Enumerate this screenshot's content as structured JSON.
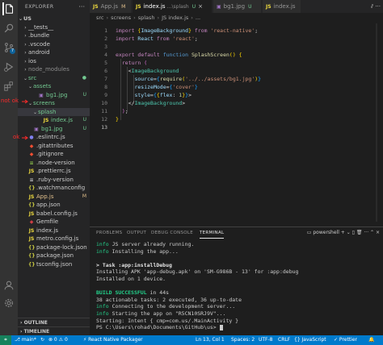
{
  "explorer": {
    "title": "EXPLORER",
    "more": "···",
    "root": "US",
    "items": [
      {
        "label": "__tests__",
        "chev": "›",
        "icon": "",
        "indent": 1,
        "status": ""
      },
      {
        "label": ".bundle",
        "chev": "›",
        "icon": "",
        "indent": 1,
        "status": ""
      },
      {
        "label": ".vscode",
        "chev": "›",
        "icon": "",
        "indent": 1,
        "status": ""
      },
      {
        "label": "android",
        "chev": "›",
        "icon": "",
        "indent": 1,
        "status": ""
      },
      {
        "label": "ios",
        "chev": "›",
        "icon": "",
        "indent": 1,
        "status": ""
      },
      {
        "label": "node_modules",
        "chev": "›",
        "icon": "",
        "indent": 1,
        "status": "",
        "cls": "ign"
      },
      {
        "label": "src",
        "chev": "⌄",
        "icon": "",
        "indent": 1,
        "status": "●",
        "cls": "untr"
      },
      {
        "label": "assets",
        "chev": "⌄",
        "icon": "",
        "indent": 2,
        "status": "",
        "cls": "untr"
      },
      {
        "label": "bg1.jpg",
        "chev": "",
        "icon": "▣",
        "iconColor": "#a074c4",
        "indent": 3,
        "status": "U",
        "cls": "untr"
      },
      {
        "label": "screens",
        "chev": "⌄",
        "icon": "",
        "indent": 2,
        "status": "",
        "cls": "untr"
      },
      {
        "label": "splash",
        "chev": "⌄",
        "icon": "",
        "indent": 3,
        "status": "",
        "cls": "untr",
        "sel": true
      },
      {
        "label": "index.js",
        "chev": "",
        "icon": "JS",
        "iconColor": "#f1dd3f",
        "indent": 4,
        "status": "U",
        "cls": "untr"
      },
      {
        "label": "bg1.jpg",
        "chev": "",
        "icon": "▣",
        "iconColor": "#a074c4",
        "indent": 2,
        "status": "U",
        "cls": "untr"
      },
      {
        "label": ".eslintrc.js",
        "chev": "",
        "icon": "●",
        "iconColor": "#8080f0",
        "indent": 1,
        "status": ""
      },
      {
        "label": ".gitattributes",
        "chev": "",
        "icon": "◆",
        "iconColor": "#f14e32",
        "indent": 1,
        "status": ""
      },
      {
        "label": ".gitignore",
        "chev": "",
        "icon": "◆",
        "iconColor": "#f14e32",
        "indent": 1,
        "status": ""
      },
      {
        "label": ".node-version",
        "chev": "",
        "icon": "≡",
        "iconColor": "#8bc34a",
        "indent": 1,
        "status": ""
      },
      {
        "label": ".prettierrc.js",
        "chev": "",
        "icon": "JS",
        "iconColor": "#f1dd3f",
        "indent": 1,
        "status": ""
      },
      {
        "label": ".ruby-version",
        "chev": "",
        "icon": "≡",
        "iconColor": "#c5c5c5",
        "indent": 1,
        "status": ""
      },
      {
        "label": ".watchmanconfig",
        "chev": "",
        "icon": "{}",
        "iconColor": "#cbcb41",
        "indent": 1,
        "status": ""
      },
      {
        "label": "App.js",
        "chev": "",
        "icon": "JS",
        "iconColor": "#f1dd3f",
        "indent": 1,
        "status": "M",
        "cls": "mod"
      },
      {
        "label": "app.json",
        "chev": "",
        "icon": "{}",
        "iconColor": "#cbcb41",
        "indent": 1,
        "status": ""
      },
      {
        "label": "babel.config.js",
        "chev": "",
        "icon": "JS",
        "iconColor": "#f1dd3f",
        "indent": 1,
        "status": ""
      },
      {
        "label": "Gemfile",
        "chev": "",
        "icon": "◆",
        "iconColor": "#cc3e44",
        "indent": 1,
        "status": ""
      },
      {
        "label": "index.js",
        "chev": "",
        "icon": "JS",
        "iconColor": "#f1dd3f",
        "indent": 1,
        "status": ""
      },
      {
        "label": "metro.config.js",
        "chev": "",
        "icon": "JS",
        "iconColor": "#f1dd3f",
        "indent": 1,
        "status": ""
      },
      {
        "label": "package-lock.json",
        "chev": "",
        "icon": "{}",
        "iconColor": "#cbcb41",
        "indent": 1,
        "status": ""
      },
      {
        "label": "package.json",
        "chev": "",
        "icon": "{}",
        "iconColor": "#cbcb41",
        "indent": 1,
        "status": ""
      },
      {
        "label": "tsconfig.json",
        "chev": "",
        "icon": "{}",
        "iconColor": "#cbcb41",
        "indent": 1,
        "status": ""
      }
    ],
    "outline": "OUTLINE",
    "timeline": "TIMELINE"
  },
  "annotations": {
    "not_ok": "not ok",
    "ok": "ok",
    "color": "#ff2a2a"
  },
  "tabs": [
    {
      "label": "App.js",
      "icon": "JS",
      "marker": "M",
      "active": false
    },
    {
      "label": "index.js",
      "icon": "JS",
      "desc": "...\\splash",
      "marker": "U",
      "close": "×",
      "active": true
    },
    {
      "label": "bg1.jpg",
      "icon": "▣",
      "marker": "U",
      "active": false
    },
    {
      "label": "index.js",
      "icon": "JS",
      "active": false
    }
  ],
  "editor_actions": "⫽ ···",
  "breadcrumb": [
    "src",
    "screens",
    "splash",
    "JS index.js",
    "..."
  ],
  "code": {
    "line_numbers": [
      "1",
      "2",
      "3",
      "4",
      "5",
      "6",
      "7",
      "8",
      "9",
      "10",
      "11",
      "12",
      "13"
    ],
    "lines": [
      [
        {
          "t": "import ",
          "c": "kw"
        },
        {
          "t": "{",
          "c": "br1"
        },
        {
          "t": "ImageBackground",
          "c": "at"
        },
        {
          "t": "}",
          "c": "br1"
        },
        {
          "t": " from ",
          "c": "kw"
        },
        {
          "t": "'react-native'",
          "c": "str"
        },
        {
          "t": ";",
          "c": "pl"
        }
      ],
      [
        {
          "t": "import ",
          "c": "kw"
        },
        {
          "t": "React",
          "c": "at"
        },
        {
          "t": " from ",
          "c": "kw"
        },
        {
          "t": "'react'",
          "c": "str"
        },
        {
          "t": ";",
          "c": "pl"
        }
      ],
      [],
      [
        {
          "t": "export ",
          "c": "kw"
        },
        {
          "t": "default ",
          "c": "kw"
        },
        {
          "t": "function ",
          "c": "kw2"
        },
        {
          "t": "SplashScreen",
          "c": "fn"
        },
        {
          "t": "()",
          "c": "br1"
        },
        {
          "t": " ",
          "c": "pl"
        },
        {
          "t": "{",
          "c": "br1"
        }
      ],
      [
        {
          "t": "  return ",
          "c": "kw"
        },
        {
          "t": "(",
          "c": "br2"
        }
      ],
      [
        {
          "t": "    <",
          "c": "pl"
        },
        {
          "t": "ImageBackground",
          "c": "tg"
        }
      ],
      [
        {
          "t": "      source",
          "c": "at"
        },
        {
          "t": "=",
          "c": "pl"
        },
        {
          "t": "{",
          "c": "br3"
        },
        {
          "t": "require",
          "c": "fn"
        },
        {
          "t": "(",
          "c": "br1"
        },
        {
          "t": "'../../assets/bg1.jpg'",
          "c": "str"
        },
        {
          "t": ")",
          "c": "br1"
        },
        {
          "t": "}",
          "c": "br3"
        }
      ],
      [
        {
          "t": "      resizeMode",
          "c": "at"
        },
        {
          "t": "=",
          "c": "pl"
        },
        {
          "t": "{",
          "c": "br3"
        },
        {
          "t": "'cover'",
          "c": "str"
        },
        {
          "t": "}",
          "c": "br3"
        }
      ],
      [
        {
          "t": "      style",
          "c": "at"
        },
        {
          "t": "=",
          "c": "pl"
        },
        {
          "t": "{",
          "c": "br3"
        },
        {
          "t": "{",
          "c": "br1"
        },
        {
          "t": "flex",
          "c": "at"
        },
        {
          "t": ": ",
          "c": "pl"
        },
        {
          "t": "1",
          "c": "num"
        },
        {
          "t": "}",
          "c": "br1"
        },
        {
          "t": "}",
          "c": "br3"
        },
        {
          "t": ">",
          "c": "pl"
        }
      ],
      [
        {
          "t": "    </",
          "c": "pl"
        },
        {
          "t": "ImageBackground",
          "c": "tg"
        },
        {
          "t": ">",
          "c": "pl"
        }
      ],
      [
        {
          "t": "  ",
          "c": "pl"
        },
        {
          "t": ")",
          "c": "br2"
        },
        {
          "t": ";",
          "c": "pl"
        }
      ],
      [
        {
          "t": "}",
          "c": "br1"
        }
      ],
      []
    ],
    "current_line": 13
  },
  "panel": {
    "tabs": [
      "PROBLEMS",
      "OUTPUT",
      "DEBUG CONSOLE",
      "TERMINAL"
    ],
    "active_tab": "TERMINAL",
    "shell": "powershell",
    "controls": "+ ⌄  ▯  🗑  ···  ⌃  ×",
    "terminal_lines": [
      [
        {
          "t": "info",
          "c": "info"
        },
        {
          "t": " JS server already running.",
          "c": ""
        }
      ],
      [
        {
          "t": "info",
          "c": "info"
        },
        {
          "t": " Installing the app...",
          "c": ""
        }
      ],
      [],
      [
        {
          "t": "> Task :app:installDebug",
          "c": "bold"
        }
      ],
      [
        {
          "t": "Installing APK 'app-debug.apk' on 'SM-G986B - 13' for :app:debug",
          "c": ""
        }
      ],
      [
        {
          "t": "Installed on 1 device.",
          "c": ""
        }
      ],
      [],
      [
        {
          "t": "BUILD SUCCESSFUL",
          "c": "ok"
        },
        {
          "t": " in 44s",
          "c": ""
        }
      ],
      [
        {
          "t": "38 actionable tasks: 2 executed, 36 up-to-date",
          "c": ""
        }
      ],
      [
        {
          "t": "info",
          "c": "info"
        },
        {
          "t": " Connecting to the development server...",
          "c": ""
        }
      ],
      [
        {
          "t": "info",
          "c": "info"
        },
        {
          "t": " Starting the app on \"R5CN10SRJ9V\"...",
          "c": ""
        }
      ],
      [
        {
          "t": "Starting: Intent { cmp=com.us/.MainActivity }",
          "c": ""
        }
      ],
      [
        {
          "t": "PS C:\\Users\\rohad\\Documents\\GitHub\\us> ",
          "c": ""
        }
      ]
    ]
  },
  "statusbar": {
    "remote": "⌗",
    "branch": "⎇ main*",
    "sync": "↻",
    "errors": "⊗ 0 ⚠ 0",
    "packager": "⚡ React Native Packager",
    "position": "Ln 13, Col 1",
    "spaces": "Spaces: 2",
    "encoding": "UTF-8",
    "eol": "CRLF",
    "language": "{} JavaScript",
    "prettier": "✓ Prettier",
    "bell": "🔔"
  },
  "colors": {
    "activity_bar": "#333333",
    "sidebar": "#252526",
    "editor": "#1e1e1e",
    "statusbar": "#007acc",
    "untracked": "#73c991",
    "modified": "#e2c08d"
  }
}
